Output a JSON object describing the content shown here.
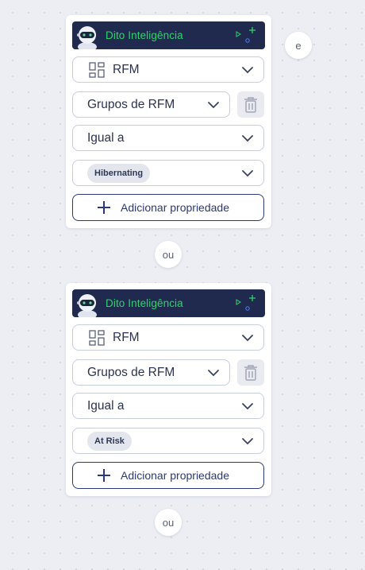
{
  "cards": [
    {
      "brand": "Dito Inteligência",
      "property": "RFM",
      "group": "Grupos de RFM",
      "operator": "Igual a",
      "value_tag": "Hibernating",
      "add_label": "Adicionar propriedade"
    },
    {
      "brand": "Dito Inteligência",
      "property": "RFM",
      "group": "Grupos de RFM",
      "operator": "Igual a",
      "value_tag": "At Risk",
      "add_label": "Adicionar propriedade"
    }
  ],
  "connectors": {
    "and_label": "e",
    "or_label_1": "ou",
    "or_label_2": "ou"
  },
  "colors": {
    "banner": "#1f2a4e",
    "brand_text": "#2ed36b",
    "accent": "#2b3a74"
  }
}
